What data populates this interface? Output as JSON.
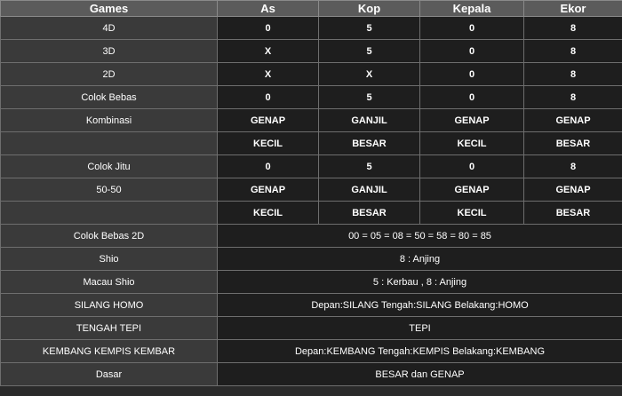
{
  "headers": [
    "Games",
    "As",
    "Kop",
    "Kepala",
    "Ekor"
  ],
  "rows4": [
    {
      "label": "4D",
      "cells": [
        "0",
        "5",
        "0",
        "8"
      ]
    },
    {
      "label": "3D",
      "cells": [
        "X",
        "5",
        "0",
        "8"
      ]
    },
    {
      "label": "2D",
      "cells": [
        "X",
        "X",
        "0",
        "8"
      ]
    },
    {
      "label": "Colok Bebas",
      "cells": [
        "0",
        "5",
        "0",
        "8"
      ]
    },
    {
      "label": "Kombinasi",
      "cells": [
        "GENAP",
        "GANJIL",
        "GENAP",
        "GENAP"
      ]
    },
    {
      "label": "",
      "cells": [
        "KECIL",
        "BESAR",
        "KECIL",
        "BESAR"
      ]
    },
    {
      "label": "Colok Jitu",
      "cells": [
        "0",
        "5",
        "0",
        "8"
      ]
    },
    {
      "label": "50-50",
      "cells": [
        "GENAP",
        "GANJIL",
        "GENAP",
        "GENAP"
      ]
    },
    {
      "label": "",
      "cells": [
        "KECIL",
        "BESAR",
        "KECIL",
        "BESAR"
      ]
    }
  ],
  "rowsSpan": [
    {
      "label": "Colok Bebas 2D",
      "value": "00 = 05 = 08 = 50 = 58 = 80 = 85"
    },
    {
      "label": "Shio",
      "value": "8 : Anjing"
    },
    {
      "label": "Macau Shio",
      "value": "5 : Kerbau , 8 : Anjing"
    },
    {
      "label": "SILANG HOMO",
      "value": "Depan:SILANG Tengah:SILANG Belakang:HOMO"
    },
    {
      "label": "TENGAH TEPI",
      "value": "TEPI"
    },
    {
      "label": "KEMBANG KEMPIS KEMBAR",
      "value": "Depan:KEMBANG Tengah:KEMPIS Belakang:KEMBANG"
    },
    {
      "label": "Dasar",
      "value": "BESAR dan GENAP"
    }
  ]
}
